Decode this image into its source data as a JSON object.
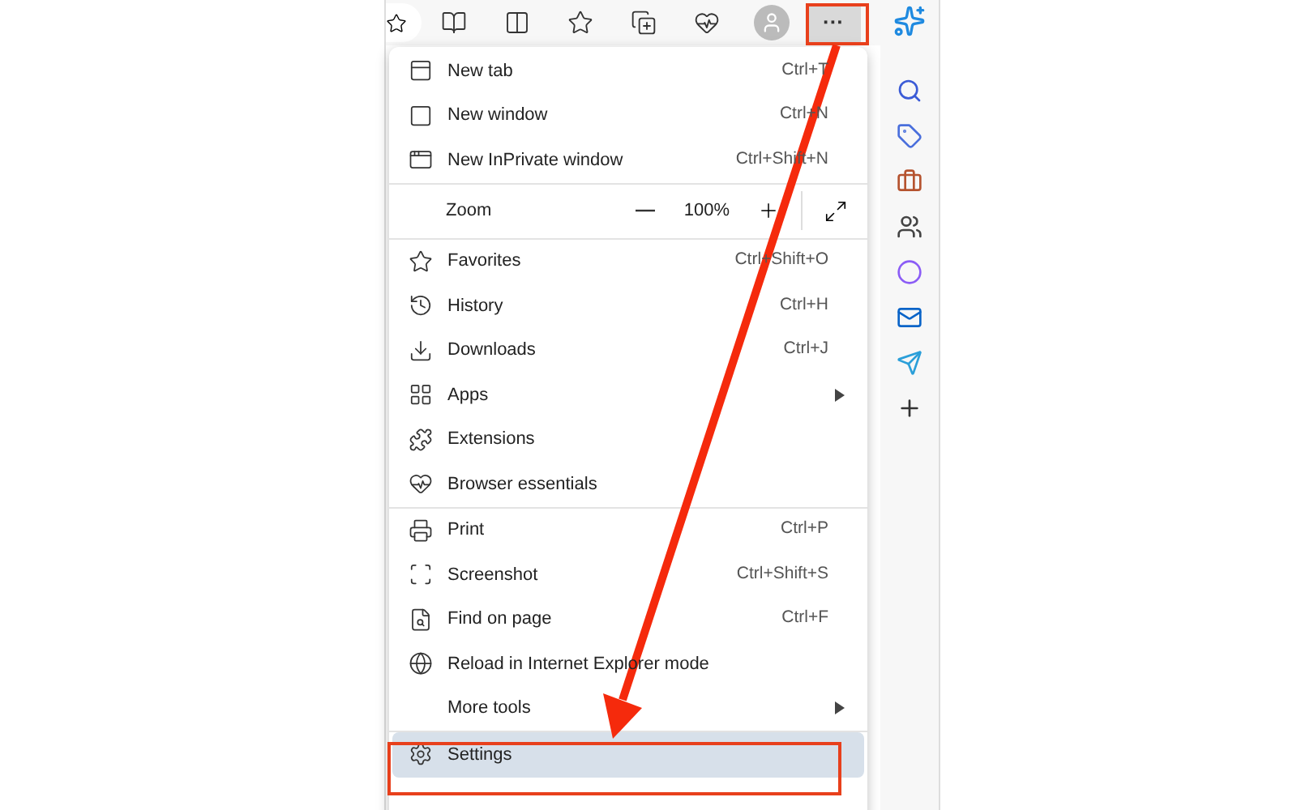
{
  "toolbar": {
    "more_button": {
      "label": "···",
      "highlighted": true
    }
  },
  "menu": {
    "sections": [
      {
        "items": [
          {
            "kind": "item",
            "label": "New tab",
            "shortcut": "Ctrl+T",
            "submenu": false,
            "selected": false
          },
          {
            "kind": "item",
            "label": "New window",
            "shortcut": "Ctrl+N",
            "submenu": false,
            "selected": false
          },
          {
            "kind": "item",
            "label": "New InPrivate window",
            "shortcut": "Ctrl+Shift+N",
            "submenu": false,
            "selected": false
          }
        ]
      },
      {
        "items": [
          {
            "kind": "zoom",
            "label": "Zoom",
            "value": "100%"
          }
        ]
      },
      {
        "items": [
          {
            "kind": "item",
            "label": "Favorites",
            "shortcut": "Ctrl+Shift+O",
            "submenu": false,
            "selected": false
          },
          {
            "kind": "item",
            "label": "History",
            "shortcut": "Ctrl+H",
            "submenu": false,
            "selected": false
          },
          {
            "kind": "item",
            "label": "Downloads",
            "shortcut": "Ctrl+J",
            "submenu": false,
            "selected": false
          },
          {
            "kind": "item",
            "label": "Apps",
            "submenu": true,
            "selected": false
          },
          {
            "kind": "item",
            "label": "Extensions",
            "submenu": false,
            "selected": false
          },
          {
            "kind": "item",
            "label": "Browser essentials",
            "submenu": false,
            "selected": false
          }
        ]
      },
      {
        "items": [
          {
            "kind": "item",
            "label": "Print",
            "shortcut": "Ctrl+P",
            "submenu": false,
            "selected": false
          },
          {
            "kind": "item",
            "label": "Screenshot",
            "shortcut": "Ctrl+Shift+S",
            "submenu": false,
            "selected": false
          },
          {
            "kind": "item",
            "label": "Find on page",
            "shortcut": "Ctrl+F",
            "submenu": false,
            "selected": false
          },
          {
            "kind": "item",
            "label": "Reload in Internet Explorer mode",
            "submenu": false,
            "selected": false
          },
          {
            "kind": "item",
            "label": "More tools",
            "submenu": true,
            "selected": false
          }
        ]
      },
      {
        "items": [
          {
            "kind": "item",
            "label": "Settings",
            "submenu": false,
            "selected": true
          }
        ]
      }
    ]
  }
}
